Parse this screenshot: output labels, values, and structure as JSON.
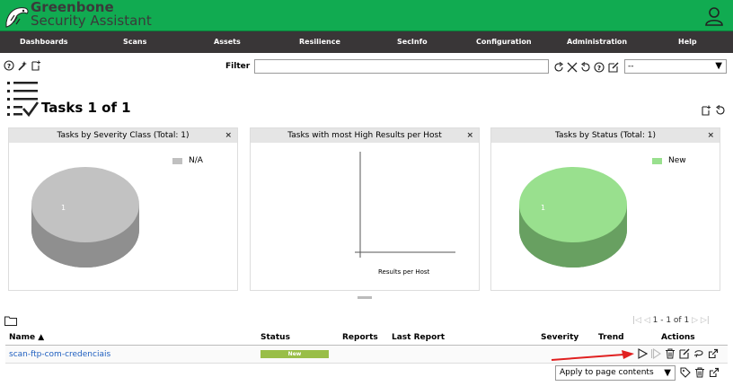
{
  "app": {
    "brand_line1": "Greenbone",
    "brand_line2": "Security Assistant"
  },
  "nav": {
    "items": [
      {
        "label": "Dashboards"
      },
      {
        "label": "Scans"
      },
      {
        "label": "Assets"
      },
      {
        "label": "Resilience"
      },
      {
        "label": "SecInfo"
      },
      {
        "label": "Configuration"
      },
      {
        "label": "Administration"
      },
      {
        "label": "Help"
      }
    ]
  },
  "toolbar": {
    "filter_label": "Filter",
    "filter_value": "",
    "filter_select_value": "--"
  },
  "page": {
    "title": "Tasks 1 of 1"
  },
  "dashboards": [
    {
      "title": "Tasks by Severity Class (Total: 1)",
      "legend": "N/A",
      "slice_label": "1",
      "color": "#c0c0c0"
    },
    {
      "title": "Tasks with most High Results per Host",
      "axis_label": "Results per Host"
    },
    {
      "title": "Tasks by Status (Total: 1)",
      "legend": "New",
      "slice_label": "1",
      "color": "#99e08e"
    }
  ],
  "close_glyph": "×",
  "pagination": {
    "text": "1 - 1 of 1"
  },
  "table": {
    "headers": {
      "name": "Name ▲",
      "status": "Status",
      "reports": "Reports",
      "last_report": "Last Report",
      "severity": "Severity",
      "trend": "Trend",
      "actions": "Actions"
    },
    "rows": [
      {
        "name": "scan-ftp-com-credenciais",
        "status": "New"
      }
    ]
  },
  "bulk": {
    "select_value": "Apply to page contents"
  },
  "colors": {
    "brand_green": "#11ab51",
    "nav_bg": "#393637",
    "status_new": "#99be48",
    "link": "#2060c0",
    "annotation_arrow": "#e02020"
  }
}
